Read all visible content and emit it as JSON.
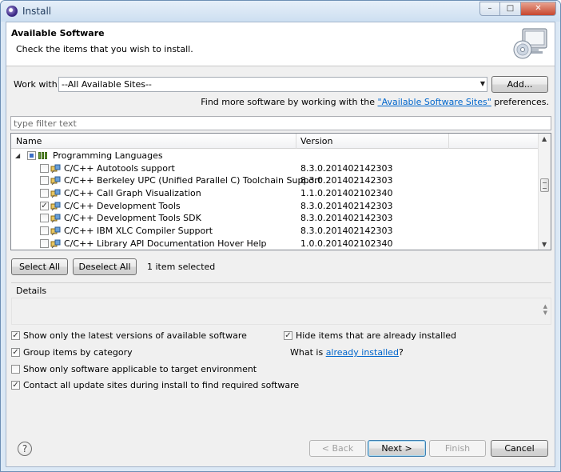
{
  "window": {
    "title": "Install",
    "min_glyph": "–",
    "max_glyph": "□",
    "close_glyph": "✕"
  },
  "banner": {
    "title": "Available Software",
    "subtitle": "Check the items that you wish to install."
  },
  "work_with": {
    "label": "Work with:",
    "value": "--All Available Sites--",
    "add_button": "Add..."
  },
  "find_more": {
    "prefix": "Find more software by working with the",
    "link": "\"Available Software Sites\"",
    "suffix": "preferences."
  },
  "filter": {
    "placeholder": "type filter text"
  },
  "tree": {
    "columns": {
      "name": "Name",
      "version": "Version"
    },
    "category": {
      "name": "Programming Languages",
      "expander": "◢"
    },
    "items": [
      {
        "name": "C/C++ Autotools support",
        "version": "8.3.0.201402142303",
        "checked": false
      },
      {
        "name": "C/C++ Berkeley UPC (Unified Parallel C) Toolchain Support",
        "version": "8.3.0.201402142303",
        "checked": false
      },
      {
        "name": "C/C++ Call Graph Visualization",
        "version": "1.1.0.201402102340",
        "checked": false
      },
      {
        "name": "C/C++ Development Tools",
        "version": "8.3.0.201402142303",
        "checked": true
      },
      {
        "name": "C/C++ Development Tools SDK",
        "version": "8.3.0.201402142303",
        "checked": false
      },
      {
        "name": "C/C++ IBM XLC Compiler Support",
        "version": "8.3.0.201402142303",
        "checked": false
      },
      {
        "name": "C/C++ Library API Documentation Hover Help",
        "version": "1.0.0.201402102340",
        "checked": false
      }
    ]
  },
  "selection": {
    "select_all": "Select All",
    "deselect_all": "Deselect All",
    "status": "1 item selected"
  },
  "details": {
    "label": "Details"
  },
  "options": {
    "latest_versions": {
      "label": "Show only the latest versions of available software",
      "checked": true
    },
    "group_by_category": {
      "label": "Group items by category",
      "checked": true
    },
    "target_env": {
      "label": "Show only software applicable to target environment",
      "checked": false
    },
    "contact_sites": {
      "label": "Contact all update sites during install to find required software",
      "checked": true
    },
    "hide_installed": {
      "label": "Hide items that are already installed",
      "checked": true
    },
    "what_is": {
      "prefix": "What is",
      "link": "already installed",
      "suffix": "?"
    }
  },
  "footer": {
    "help": "?",
    "back": "< Back",
    "next": "Next >",
    "finish": "Finish",
    "cancel": "Cancel"
  },
  "check_glyph": "✓"
}
